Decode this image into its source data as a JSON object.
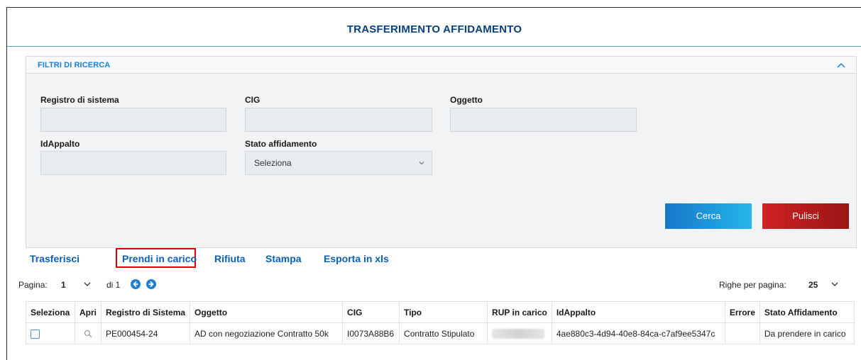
{
  "page": {
    "title": "TRASFERIMENTO AFFIDAMENTO"
  },
  "filters": {
    "title": "FILTRI DI RICERCA",
    "registro_label": "Registro di sistema",
    "registro_value": "",
    "cig_label": "CIG",
    "cig_value": "",
    "oggetto_label": "Oggetto",
    "oggetto_value": "",
    "idappalto_label": "IdAppalto",
    "idappalto_value": "",
    "stato_label": "Stato affidamento",
    "stato_value": "Seleziona",
    "search_label": "Cerca",
    "clear_label": "Pulisci"
  },
  "actions": {
    "trasferisci": "Trasferisci",
    "prendi": "Prendi in carico",
    "rifiuta": "Rifiuta",
    "stampa": "Stampa",
    "esporta": "Esporta in xls"
  },
  "pager": {
    "page_label": "Pagina:",
    "page_value": "1",
    "of_label": "di 1",
    "rows_label": "Righe per pagina:",
    "rows_value": "25"
  },
  "table": {
    "headers": [
      "Seleziona",
      "Apri",
      "Registro di Sistema",
      "Oggetto",
      "CIG",
      "Tipo",
      "RUP in carico",
      "IdAppalto",
      "Errore",
      "Stato Affidamento"
    ],
    "rows": [
      {
        "registro": "PE000454-24",
        "oggetto": "AD con negoziazione Contratto 50k",
        "cig": "I0073A88B6",
        "tipo": "Contratto Stipulato",
        "idappalto": "4ae880c3-4d94-40e8-84ca-c7af9ee5347c",
        "errore": "",
        "stato": "Da prendere in carico"
      }
    ]
  },
  "icons": {
    "collapse": "chevron-up-icon",
    "select_chevron": "chevron-down-icon",
    "prev": "arrow-left-circle-icon",
    "next": "arrow-right-circle-icon",
    "open": "search-icon"
  },
  "colors": {
    "accent_blue": "#1e7fd0",
    "title_blue": "#0b3f7a",
    "danger_red": "#cf2222",
    "highlight_red": "#e00000"
  }
}
